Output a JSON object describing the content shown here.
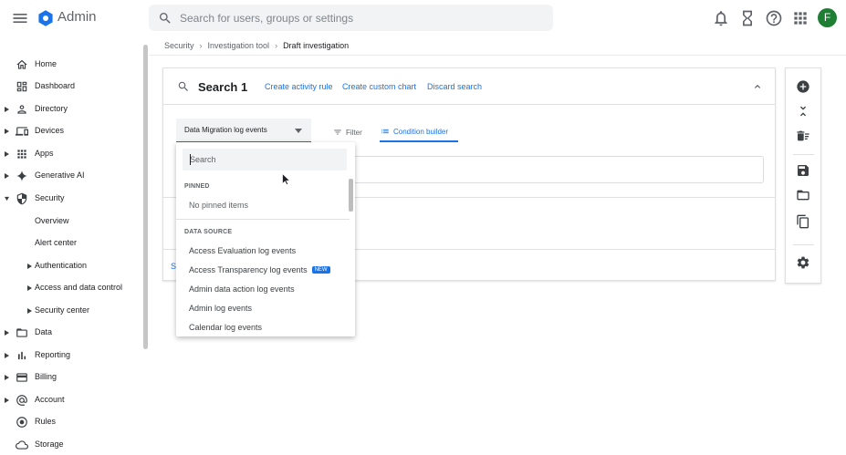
{
  "topbar": {
    "app_name": "Admin",
    "search_placeholder": "Search for users, groups or settings",
    "avatar_initial": "F"
  },
  "breadcrumb": {
    "items": [
      "Security",
      "Investigation tool",
      "Draft investigation"
    ]
  },
  "sidebar": {
    "items": [
      {
        "label": "Home",
        "icon": "home-icon"
      },
      {
        "label": "Dashboard",
        "icon": "dashboard-icon"
      },
      {
        "label": "Directory",
        "icon": "person-icon"
      },
      {
        "label": "Devices",
        "icon": "devices-icon"
      },
      {
        "label": "Apps",
        "icon": "apps-grid-icon"
      },
      {
        "label": "Generative AI",
        "icon": "sparkle-icon"
      },
      {
        "label": "Security",
        "icon": "shield-icon"
      },
      {
        "label": "Overview"
      },
      {
        "label": "Alert center"
      },
      {
        "label": "Authentication"
      },
      {
        "label": "Access and data control"
      },
      {
        "label": "Security center"
      },
      {
        "label": "Data",
        "icon": "folder-icon"
      },
      {
        "label": "Reporting",
        "icon": "bar-chart-icon"
      },
      {
        "label": "Billing",
        "icon": "credit-card-icon"
      },
      {
        "label": "Account",
        "icon": "at-sign-icon"
      },
      {
        "label": "Rules",
        "icon": "rules-icon"
      },
      {
        "label": "Storage",
        "icon": "cloud-icon"
      }
    ]
  },
  "search_card": {
    "title": "Search 1",
    "links": {
      "create_activity_rule": "Create activity rule",
      "create_custom_chart": "Create custom chart",
      "discard_search": "Discard search"
    },
    "data_source_select": "Data Migration log events",
    "tabs": {
      "filter": "Filter",
      "condition_builder": "Condition builder"
    },
    "partial_link": "S"
  },
  "dropdown": {
    "search_placeholder": "Search",
    "pinned_header": "PINNED",
    "pinned_empty": "No pinned items",
    "data_source_header": "DATA SOURCE",
    "items": [
      {
        "label": "Access Evaluation log events"
      },
      {
        "label": "Access Transparency log events",
        "badge": "NEW"
      },
      {
        "label": "Admin data action log events"
      },
      {
        "label": "Admin log events"
      },
      {
        "label": "Calendar log events"
      }
    ]
  },
  "colors": {
    "accent": "#1a73e8",
    "avatar_bg": "#1e7e34"
  }
}
